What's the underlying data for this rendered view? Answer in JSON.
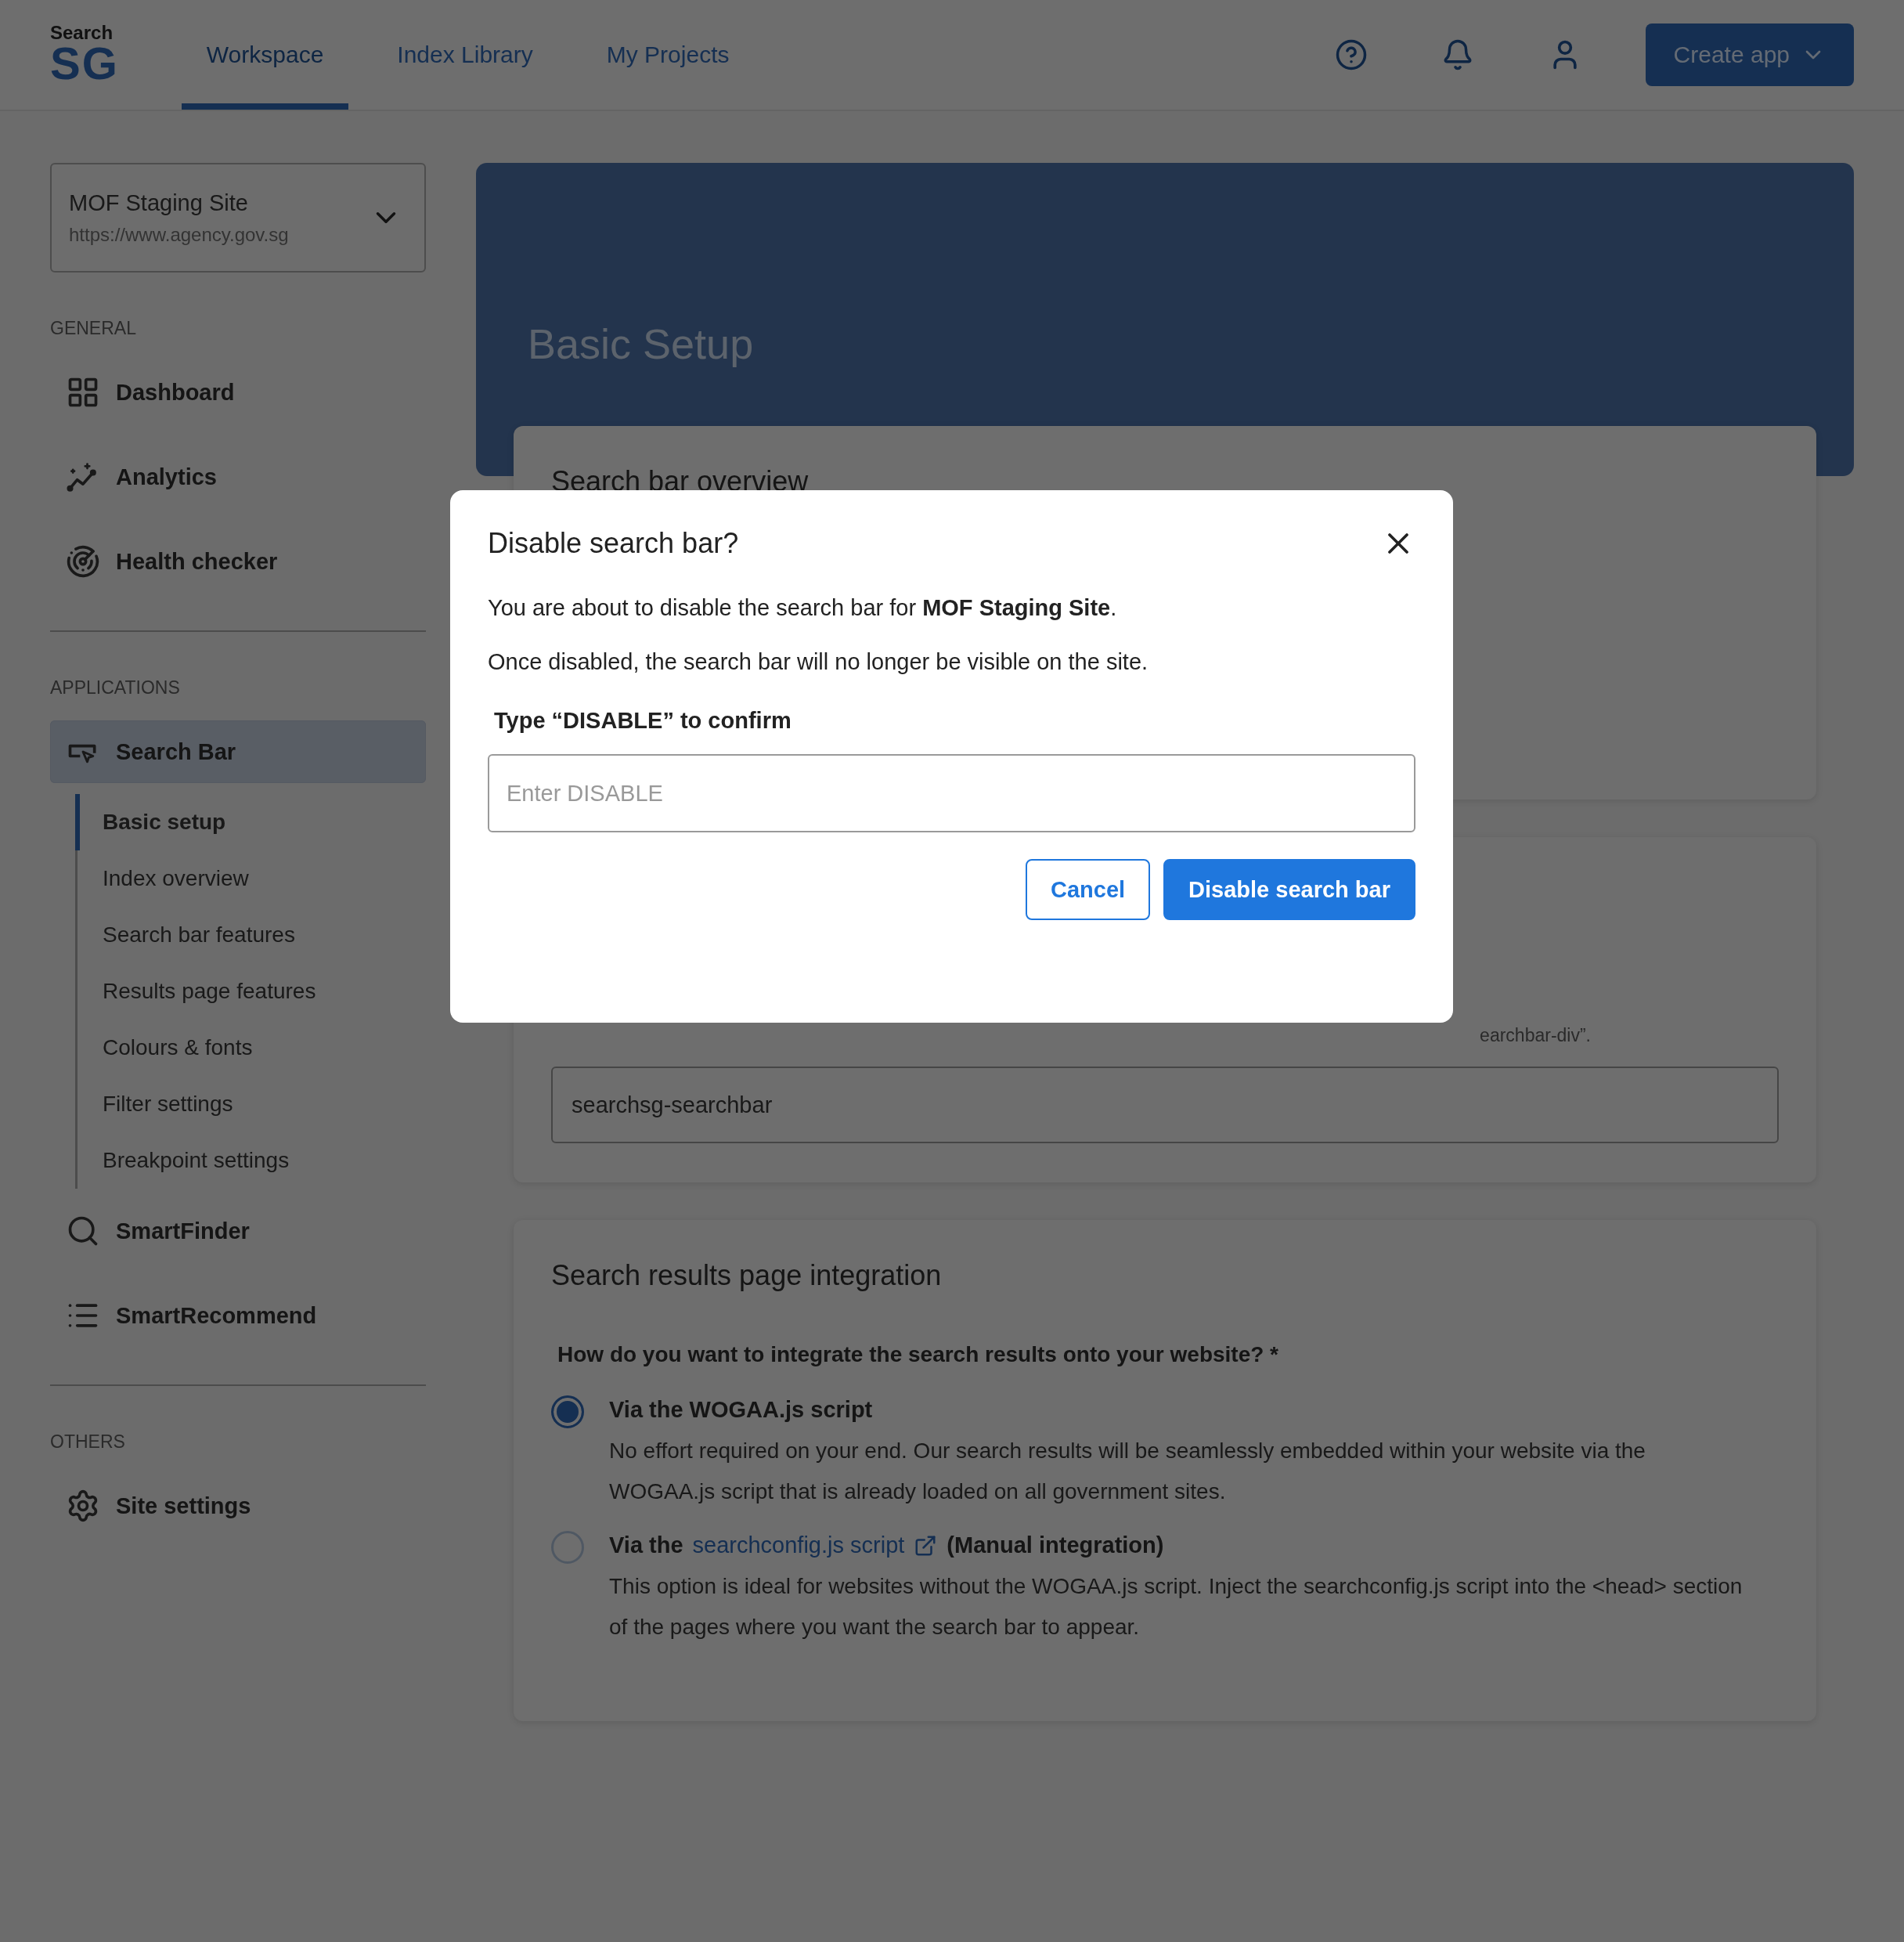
{
  "header": {
    "logo": {
      "top": "Search",
      "main": "SG"
    },
    "tabs": [
      {
        "label": "Workspace",
        "selected": true
      },
      {
        "label": "Index Library",
        "selected": false
      },
      {
        "label": "My Projects",
        "selected": false
      }
    ],
    "create_button": "Create app"
  },
  "sidebar": {
    "site_selector": {
      "name": "MOF Staging Site",
      "url": "https://www.agency.gov.sg"
    },
    "sections": [
      {
        "heading": "GENERAL",
        "items": [
          {
            "label": "Dashboard",
            "selected": false
          },
          {
            "label": "Analytics",
            "selected": false
          },
          {
            "label": "Health checker",
            "selected": false
          }
        ]
      },
      {
        "heading": "APPLICATIONS",
        "items": [
          {
            "label": "Search Bar",
            "selected": true,
            "children": [
              {
                "label": "Basic setup",
                "selected": true
              },
              {
                "label": "Index overview",
                "selected": false
              },
              {
                "label": "Search bar features",
                "selected": false
              },
              {
                "label": "Results page features",
                "selected": false
              },
              {
                "label": "Colours & fonts",
                "selected": false
              },
              {
                "label": "Filter settings",
                "selected": false
              },
              {
                "label": "Breakpoint settings",
                "selected": false
              }
            ]
          },
          {
            "label": "SmartFinder",
            "selected": false
          },
          {
            "label": "SmartRecommend",
            "selected": false
          }
        ]
      },
      {
        "heading": "OTHERS",
        "items": [
          {
            "label": "Site settings",
            "selected": false
          }
        ]
      }
    ]
  },
  "main": {
    "banner_title": "Basic Setup",
    "overview_card": {
      "heading": "Search bar overview"
    },
    "element_card": {
      "hint": "earchbar-div”.",
      "value": "searchsg-searchbar"
    },
    "integration_card": {
      "heading": "Search results page integration",
      "question": "How do you want to integrate the search results onto your website? *",
      "options": [
        {
          "selected": true,
          "title": "Via the WOGAA.js script",
          "description": "No effort required on your end. Our search results will be seamlessly embedded within your website via the WOGAA.js script that is already loaded on all government sites."
        },
        {
          "selected": false,
          "title": "Via the",
          "link": "searchconfig.js script",
          "title_after": "(Manual integration)",
          "description": "This option is ideal for websites without the WOGAA.js script. Inject the searchconfig.js script into the <head> section of the pages where you want the search bar to appear."
        }
      ]
    }
  },
  "modal": {
    "title": "Disable search bar?",
    "body": [
      "You are about to disable the search bar for **MOF Staging Site**.",
      "Once disabled, the search bar will no longer be visible on the site."
    ],
    "confirm_label": "Type “DISABLE” to confirm",
    "placeholder": "Enter DISABLE",
    "cancel": "Cancel",
    "confirm": "Disable search bar"
  }
}
